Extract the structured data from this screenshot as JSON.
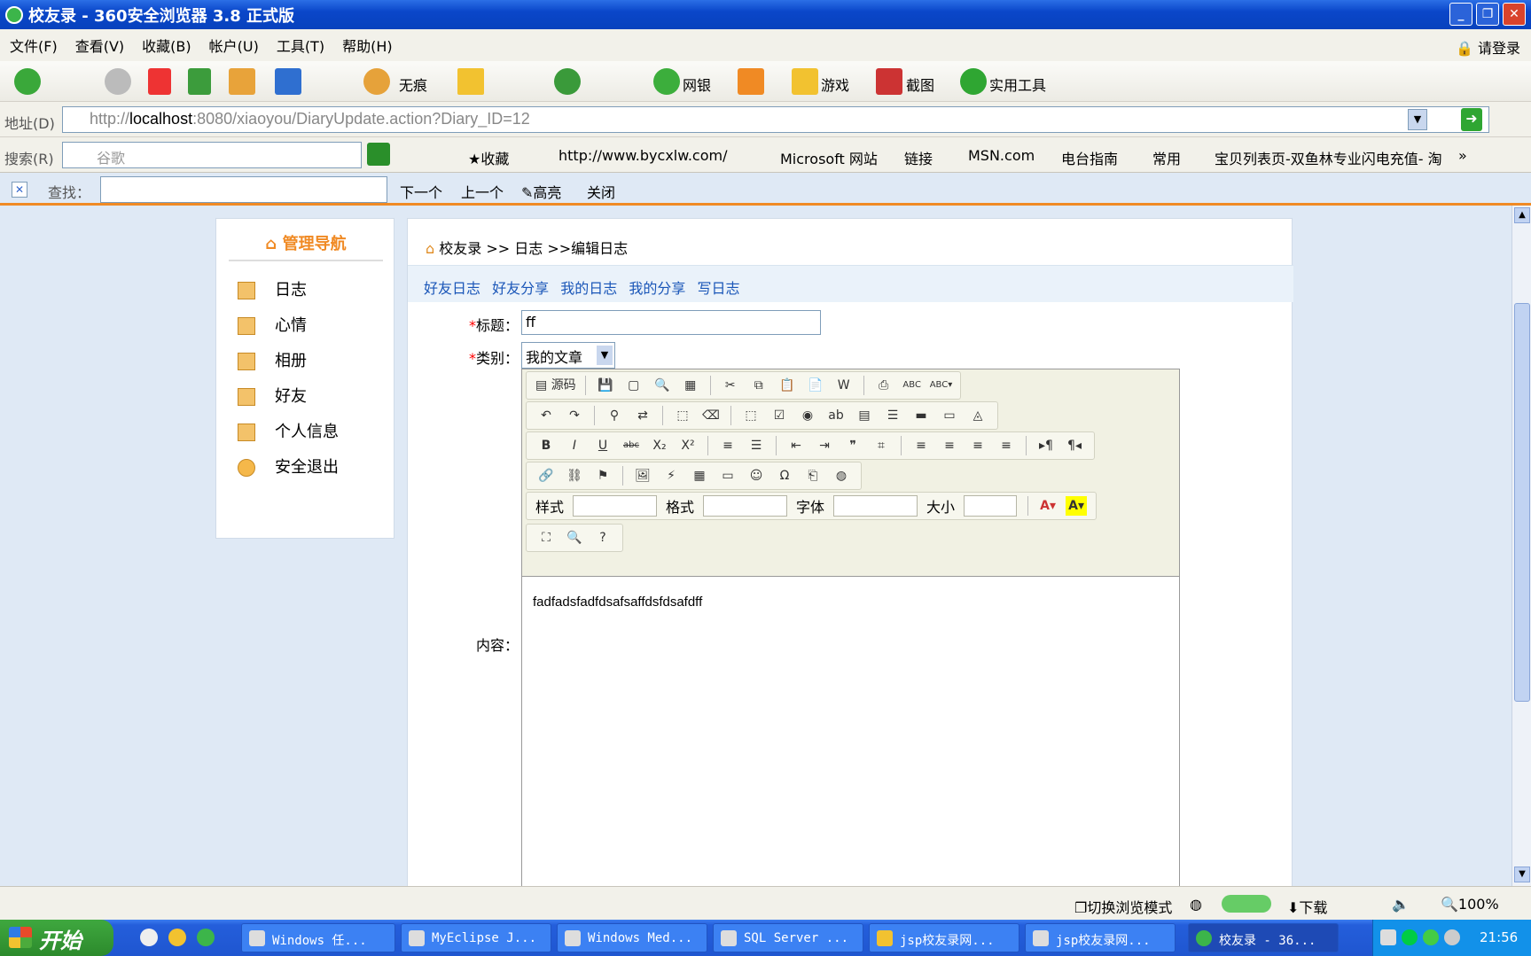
{
  "window": {
    "title": "校友录 - 360安全浏览器 3.8 正式版",
    "buttons": [
      "_",
      "❐",
      "✕"
    ]
  },
  "menu": {
    "items": [
      "文件(F)",
      "查看(V)",
      "收藏(B)",
      "帐户(U)",
      "工具(T)",
      "帮助(H)"
    ],
    "login": "请登录"
  },
  "toolbar": {
    "no_trace": "无痕",
    "bank": "网银",
    "games": "游戏",
    "screenshot": "截图",
    "tools": "实用工具"
  },
  "address": {
    "label": "地址(D)",
    "url_prefix": "http://",
    "url_host": "localhost",
    "url_rest": ":8080/xiaoyou/DiaryUpdate.action?Diary_ID=12"
  },
  "search": {
    "label": "搜索(R)",
    "placeholder": "谷歌"
  },
  "favorites": {
    "collect": "收藏",
    "items": [
      "http://www.bycxlw.com/",
      "Microsoft 网站",
      "链接",
      "MSN.com",
      "电台指南",
      "常用",
      "宝贝列表页-双鱼林专业闪电充值- 淘"
    ]
  },
  "findbar": {
    "label": "查找：",
    "next": "下一个",
    "prev": "上一个",
    "highlight": "高亮",
    "close": "关闭"
  },
  "sidebar": {
    "title": "管理导航",
    "items": [
      "日志",
      "心情",
      "相册",
      "好友",
      "个人信息",
      "安全退出"
    ]
  },
  "main": {
    "breadcrumb": "校友录 >> 日志 >>编辑日志",
    "tabs": [
      "好友日志",
      "好友分享",
      "我的日志",
      "我的分享",
      "写日志"
    ],
    "title_label": "标题：",
    "title_value": "ff",
    "category_label": "类别：",
    "category_value": "我的文章",
    "content_label": "内容：",
    "content_value": "fadfadsfadfdsafsaffdsfdsafdff",
    "required_mark": "*"
  },
  "editor": {
    "source": "源码",
    "style": "样式",
    "format": "格式",
    "font": "字体",
    "size": "大小"
  },
  "status": {
    "mode": "切换浏览模式",
    "download": "下载",
    "zoom": "100%"
  },
  "taskbar": {
    "start": "开始",
    "tasks": [
      "Windows 任...",
      "MyEclipse J...",
      "Windows Med...",
      "SQL Server ...",
      "jsp校友录网...",
      "jsp校友录网...",
      "校友录 - 36..."
    ],
    "clock": "21:56"
  }
}
